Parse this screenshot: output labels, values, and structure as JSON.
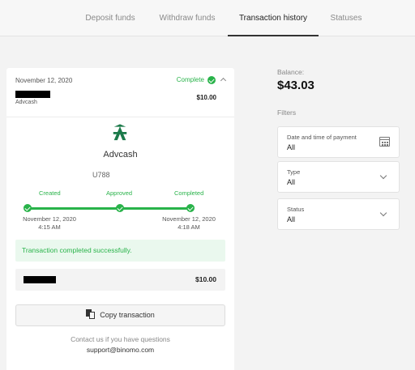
{
  "tabs": [
    {
      "label": "Deposit funds"
    },
    {
      "label": "Withdraw funds"
    },
    {
      "label": "Transaction history"
    },
    {
      "label": "Statuses"
    }
  ],
  "active_tab": "Transaction history",
  "transaction": {
    "date": "November 12, 2020",
    "status": "Complete",
    "method_sub": "Advcash",
    "amount": "$10.00",
    "method_name": "Advcash",
    "account": "U788",
    "steps": [
      {
        "label": "Created",
        "date": "November 12, 2020",
        "time": "4:15 AM"
      },
      {
        "label": "Approved",
        "date": "",
        "time": ""
      },
      {
        "label": "Completed",
        "date": "November 12, 2020",
        "time": "4:18 AM"
      }
    ],
    "success_message": "Transaction completed successfully.",
    "detail_amount": "$10.00",
    "copy_label": "Copy transaction",
    "contact_text": "Contact us if you have questions",
    "support_email": "support@binomo.com"
  },
  "balance": {
    "label": "Balance:",
    "value": "$43.03"
  },
  "filters": {
    "label": "Filters",
    "items": [
      {
        "label": "Date and time of payment",
        "value": "All",
        "icon": "calendar-icon"
      },
      {
        "label": "Type",
        "value": "All",
        "icon": "chevron-down-icon"
      },
      {
        "label": "Status",
        "value": "All",
        "icon": "chevron-down-icon"
      }
    ]
  },
  "colors": {
    "success": "#29b34a",
    "brand_logo": "#1c7a4a"
  }
}
